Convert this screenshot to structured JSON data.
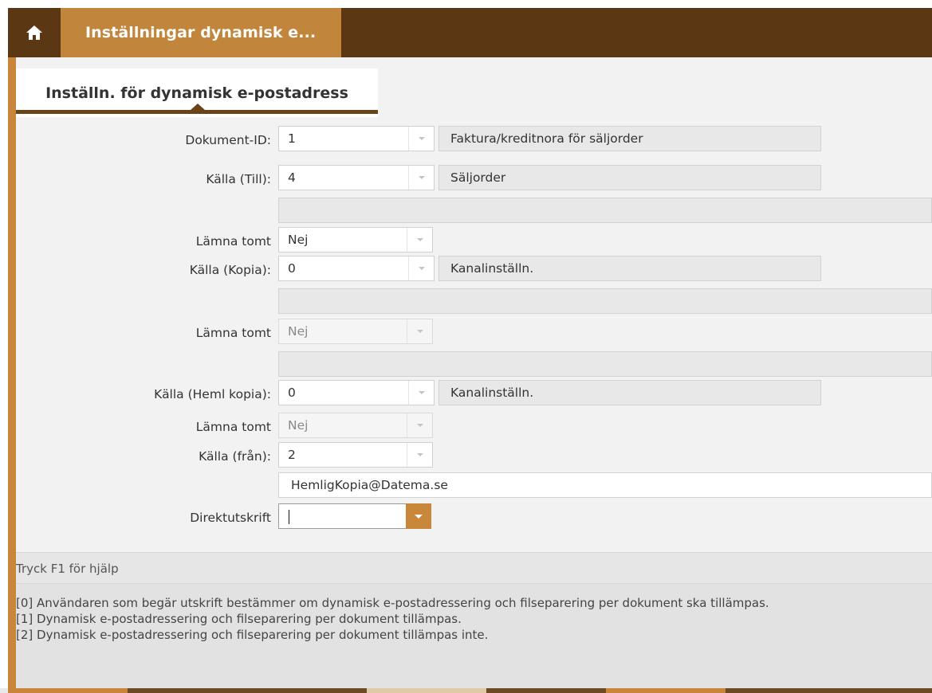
{
  "titlebar": {
    "home_icon": "home-icon",
    "title": "Inställningar dynamisk e..."
  },
  "tabs": {
    "active_label": "Inställn. för dynamisk e-postadress"
  },
  "form": {
    "dokument_id": {
      "label": "Dokument-ID:",
      "value": "1",
      "description": "Faktura/kreditnora för säljorder"
    },
    "kalla_till": {
      "label": "Källa (Till):",
      "value": "4",
      "description": "Säljorder"
    },
    "lamna_tomt_1": {
      "label": "Lämna tomt",
      "value": "Nej"
    },
    "kalla_kopia": {
      "label": "Källa (Kopia):",
      "value": "0",
      "description": "Kanalinställn."
    },
    "lamna_tomt_2": {
      "label": "Lämna tomt",
      "value": "Nej"
    },
    "kalla_heml_kopia": {
      "label": "Källa (Heml kopia):",
      "value": "0",
      "description": "Kanalinställn."
    },
    "lamna_tomt_3": {
      "label": "Lämna tomt",
      "value": "Nej"
    },
    "kalla_fran": {
      "label": "Källa (från):",
      "value": "2"
    },
    "email": {
      "value": "HemligKopia@Datema.se"
    },
    "direktutskrift": {
      "label": "Direktutskrift",
      "value": ""
    }
  },
  "help": {
    "title": "Tryck F1 för hjälp",
    "lines": [
      "[0] Användaren som begär utskrift bestämmer om dynamisk e-postadressering och filseparering per dokument ska tillämpas.",
      "[1] Dynamisk e-postadressering och filseparering per dokument tillämpas.",
      "[2] Dynamisk e-postadressering och filseparering per dokument tillämpas inte."
    ]
  },
  "colors": {
    "title_bar": "#5c3713",
    "accent": "#c1863c",
    "frame_border": "#c9863a",
    "panel_bg": "#f2f2f2"
  }
}
